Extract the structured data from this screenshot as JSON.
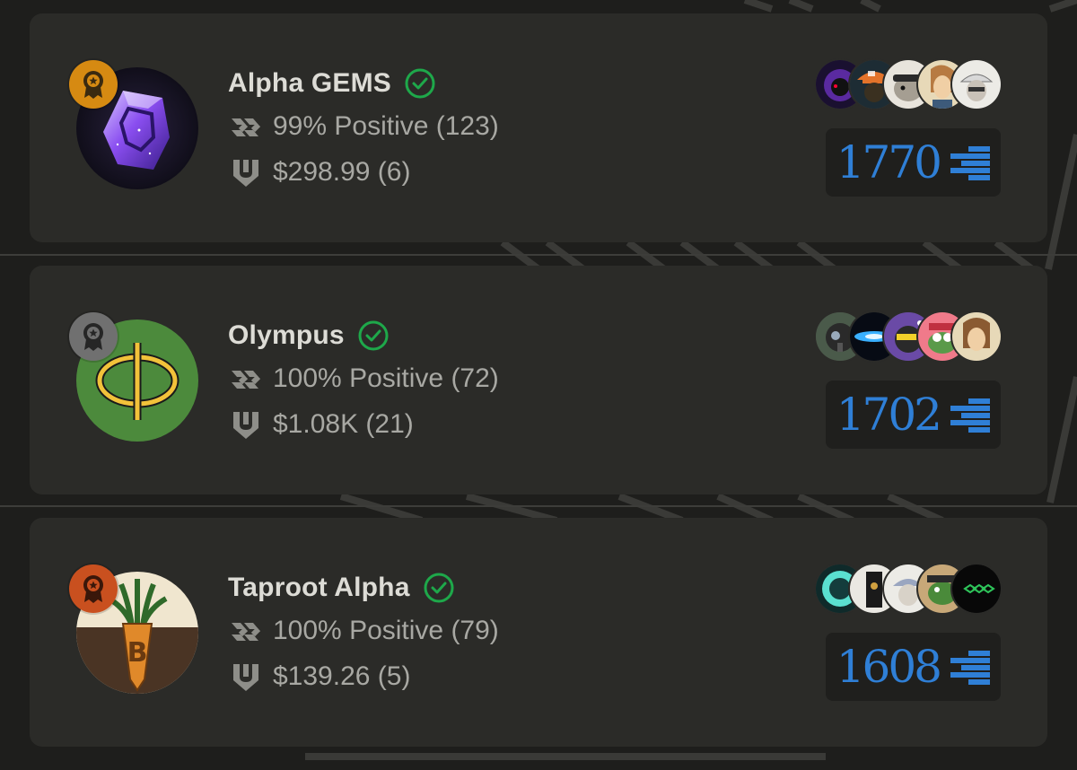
{
  "colors": {
    "accent_blue": "#2f7fd6",
    "verified_green": "#1ea84a",
    "rank_gold": "#d68a12",
    "rank_silver": "#707070",
    "rank_bronze": "#c9501f",
    "card_bg": "#2b2b28",
    "page_bg": "#1e1e1c"
  },
  "entries": [
    {
      "name": "Alpha GEMS",
      "verified": true,
      "rank_icon": "gold-award-icon",
      "avatar_icon": "purple-crystal-gem-avatar",
      "rating": "99% Positive (123)",
      "sales": "$298.99 (6)",
      "score": "1770",
      "member_avatars": [
        "purple-hood-avatar",
        "orange-cap-avatar",
        "gray-creature-avatar",
        "portrait-avatar",
        "white-cap-avatar"
      ]
    },
    {
      "name": "Olympus",
      "verified": true,
      "rank_icon": "silver-award-icon",
      "avatar_icon": "phi-symbol-avatar",
      "rating": "100% Positive (72)",
      "sales": "$1.08K (21)",
      "score": "1702",
      "member_avatars": [
        "gas-mask-avatar",
        "blue-light-avatar",
        "purple-ape-avatar",
        "pink-pepe-avatar",
        "portrait-avatar"
      ]
    },
    {
      "name": "Taproot Alpha",
      "verified": true,
      "rank_icon": "bronze-award-icon",
      "avatar_icon": "bitcoin-carrot-avatar",
      "rating": "100% Positive (79)",
      "sales": "$139.26 (5)",
      "score": "1608",
      "member_avatars": [
        "teal-orb-avatar",
        "dark-figure-avatar",
        "white-cap-avatar",
        "green-frog-avatar",
        "green-cubes-avatar"
      ]
    }
  ]
}
